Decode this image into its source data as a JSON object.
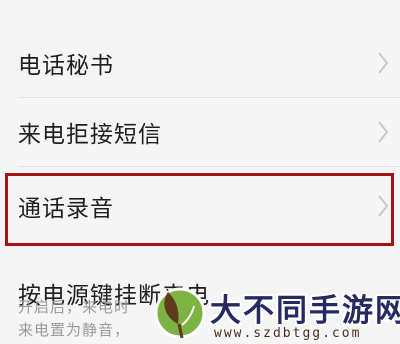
{
  "settings": {
    "items": [
      {
        "label": "电话秘书"
      },
      {
        "label": "来电拒接短信"
      },
      {
        "label": "通话录音"
      },
      {
        "label": "按电源键挂断来电",
        "desc_line1": "开启后，来电时",
        "desc_line1_tail": "",
        "desc_line2": "来电置为静音，"
      }
    ]
  },
  "watermark": {
    "brand": "大不同手游网",
    "url": "www.szdbtgg.com"
  },
  "colors": {
    "highlight": "#a41212",
    "watermark_text": "#262a63"
  }
}
